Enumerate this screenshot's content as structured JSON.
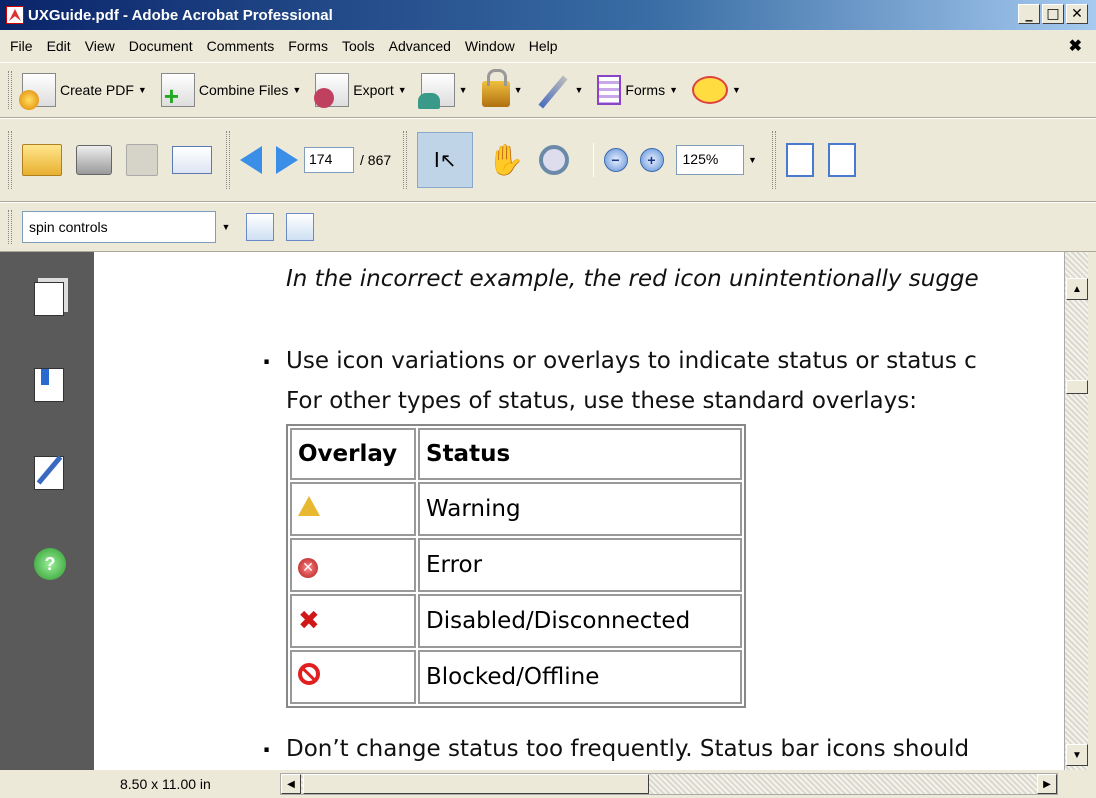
{
  "window": {
    "title": "UXGuide.pdf - Adobe Acrobat Professional",
    "min_label": "_",
    "max_label": "□",
    "close_label": "✕"
  },
  "menu": {
    "items": [
      "File",
      "Edit",
      "View",
      "Document",
      "Comments",
      "Forms",
      "Tools",
      "Advanced",
      "Window",
      "Help"
    ],
    "close_label": "✖"
  },
  "toolbar1": {
    "create_pdf": "Create PDF",
    "combine_files": "Combine Files",
    "export": "Export",
    "forms": "Forms",
    "arrow": "▼"
  },
  "toolbar2": {
    "page_current": "174",
    "page_total": "/ 867",
    "zoom": "125%",
    "zoom_out": "−",
    "zoom_in": "+",
    "select_glyph": "I↖",
    "hand_glyph": "✋"
  },
  "toolbar3": {
    "search_value": "spin controls"
  },
  "navpane": {
    "help_label": "?"
  },
  "document": {
    "line1": "In the incorrect example, the red icon unintentionally sugge",
    "bullet": ".",
    "line2": "Use icon variations or overlays to indicate status or status c",
    "line3": "For other types of status, use these standard overlays:",
    "table_headers": [
      "Overlay",
      "Status"
    ],
    "table_rows": [
      {
        "icon": "warning-icon",
        "status": "Warning"
      },
      {
        "icon": "error-icon",
        "status": "Error"
      },
      {
        "icon": "disabled-icon",
        "status": "Disabled/Disconnected"
      },
      {
        "icon": "blocked-icon",
        "status": "Blocked/Offline"
      }
    ],
    "error_glyph": "✕",
    "disabled_glyph": "✖",
    "line4": "Don’t change status too frequently. Status bar icons should"
  },
  "statusbar": {
    "page_size": "8.50 x 11.00 in"
  },
  "scroll": {
    "up": "▲",
    "down": "▼",
    "left": "◀",
    "right": "▶"
  }
}
